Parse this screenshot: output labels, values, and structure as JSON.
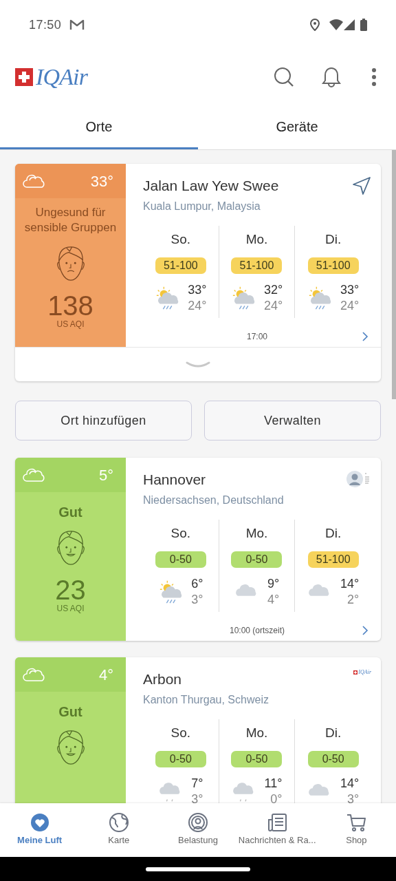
{
  "status_bar": {
    "time": "17:50"
  },
  "header": {
    "logo": "IQAir"
  },
  "tabs": [
    {
      "label": "Orte",
      "selected": true
    },
    {
      "label": "Geräte",
      "selected": false
    }
  ],
  "locations": [
    {
      "kind": "unhealthy-sensitive",
      "color": "#f0a063",
      "temperature": "33°",
      "category": "Ungesund für sensible Gruppen",
      "aqi": "138",
      "aqi_unit": "US AQI",
      "name": "Jalan Law Yew Swee",
      "region": "Kuala Lumpur, Malaysia",
      "source": {
        "kind": "location"
      },
      "forecast": [
        {
          "day": "So.",
          "range": "51-100",
          "color": "#f6d35c",
          "kind": "sun-rain",
          "high": "33°",
          "low": "24°"
        },
        {
          "day": "Mo.",
          "range": "51-100",
          "color": "#f6d35c",
          "kind": "sun-rain",
          "high": "32°",
          "low": "24°"
        },
        {
          "day": "Di.",
          "range": "51-100",
          "color": "#f6d35c",
          "kind": "sun-rain",
          "high": "33°",
          "low": "24°"
        }
      ],
      "updated": "17:00",
      "expandable": true
    },
    {
      "kind": "good",
      "color": "#b1dd6f",
      "temperature": "5°",
      "category": "Gut",
      "aqi": "23",
      "aqi_unit": "US AQI",
      "name": "Hannover",
      "region": "Niedersachsen, Deutschland",
      "source": {
        "kind": "user"
      },
      "forecast": [
        {
          "day": "So.",
          "range": "0-50",
          "color": "#b1dd6f",
          "kind": "sun-rain",
          "high": "6°",
          "low": "3°"
        },
        {
          "day": "Mo.",
          "range": "0-50",
          "color": "#b1dd6f",
          "kind": "cloud",
          "high": "9°",
          "low": "4°"
        },
        {
          "day": "Di.",
          "range": "51-100",
          "color": "#f6d35c",
          "kind": "cloud",
          "high": "14°",
          "low": "2°"
        }
      ],
      "updated": "10:00 (ortszeit)",
      "expandable": false
    },
    {
      "kind": "good",
      "color": "#b1dd6f",
      "temperature": "4°",
      "category": "Gut",
      "name": "Arbon",
      "region": "Kanton Thurgau, Schweiz",
      "source": {
        "kind": "iqair",
        "label": "IQAir"
      },
      "forecast": [
        {
          "day": "So.",
          "range": "0-50",
          "color": "#b1dd6f",
          "kind": "cloud-rain",
          "high": "7°",
          "low": "3°"
        },
        {
          "day": "Mo.",
          "range": "0-50",
          "color": "#b1dd6f",
          "kind": "cloud-rain",
          "high": "11°",
          "low": "0°"
        },
        {
          "day": "Di.",
          "range": "0-50",
          "color": "#b1dd6f",
          "kind": "cloud",
          "high": "14°",
          "low": "3°"
        }
      ],
      "expandable": false
    }
  ],
  "actions": [
    "Ort hinzufügen",
    "Verwalten"
  ],
  "nav": [
    {
      "label": "Meine Luft",
      "selected": true
    },
    {
      "label": "Karte",
      "selected": false
    },
    {
      "label": "Belastung",
      "selected": false
    },
    {
      "label": "Nachrichten & Ra...",
      "selected": false
    },
    {
      "label": "Shop",
      "selected": false
    }
  ]
}
